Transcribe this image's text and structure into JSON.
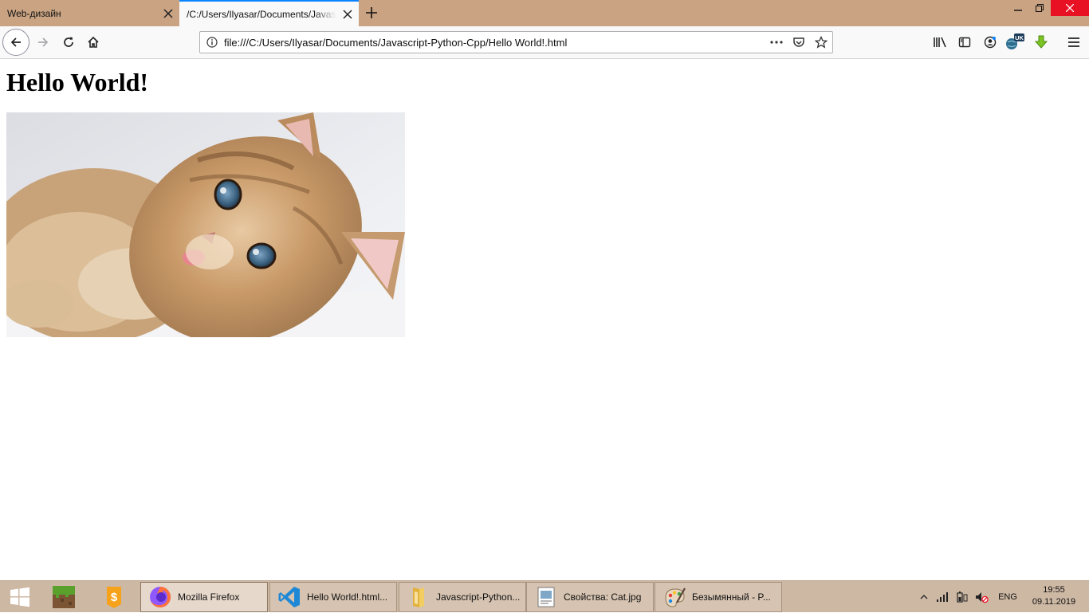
{
  "browser": {
    "tabs": [
      {
        "title": "Web-дизайн",
        "active": false
      },
      {
        "title": "/C:/Users/Ilyasar/Documents/Javascript-Python-Cpp/Hello World!.html",
        "active": true
      }
    ],
    "url": "file:///C:/Users/Ilyasar/Documents/Javascript-Python-Cpp/Hello World!.html",
    "ext_badge": "UK",
    "colors": {
      "tabstrip": "#c9a382",
      "accent": "#0a84ff",
      "close": "#e81123"
    }
  },
  "page": {
    "heading": "Hello World!",
    "image": {
      "subject": "kitten",
      "icon": "cat-photo"
    }
  },
  "taskbar": {
    "pinned": [
      {
        "icon": "minecraft-icon"
      },
      {
        "icon": "app-badge-icon"
      }
    ],
    "windows": [
      {
        "label": "Mozilla Firefox",
        "icon": "firefox-icon",
        "active": true
      },
      {
        "label": "Hello World!.html...",
        "icon": "vscode-icon",
        "active": false
      },
      {
        "label": "Javascript-Python...",
        "icon": "folder-icon",
        "active": false
      },
      {
        "label": "Свойства: Cat.jpg",
        "icon": "properties-icon",
        "active": false
      },
      {
        "label": "Безымянный - P...",
        "icon": "paint-icon",
        "active": false
      }
    ],
    "language": "ENG",
    "time": "19:55",
    "date": "09.11.2019"
  }
}
